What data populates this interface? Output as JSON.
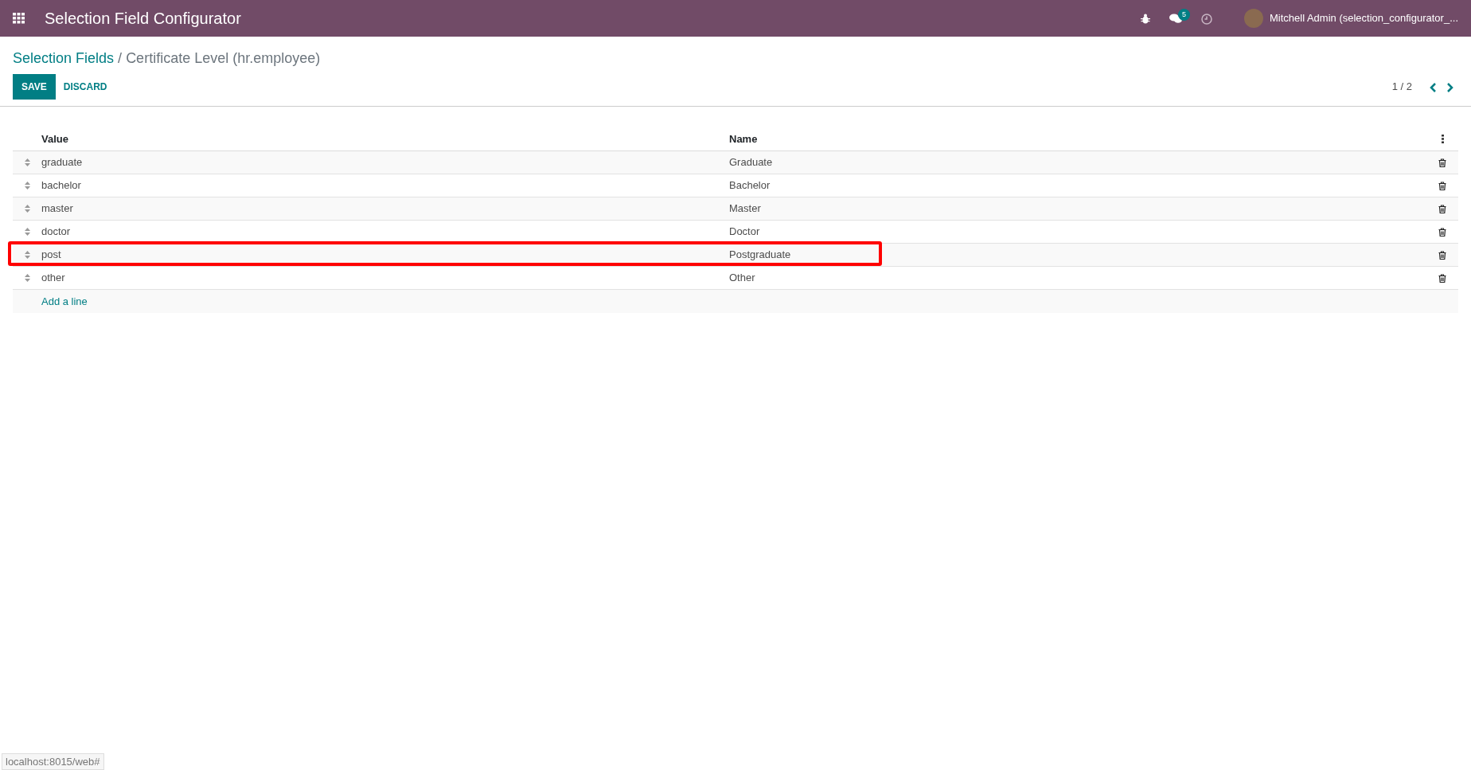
{
  "navbar": {
    "app_title": "Selection Field Configurator",
    "message_count": "5",
    "user": "Mitchell Admin (selection_configurator_..."
  },
  "breadcrumb": {
    "parent": "Selection Fields",
    "separator": "/",
    "current": "Certificate Level (hr.employee)"
  },
  "buttons": [
    "SAVE",
    "DISCARD"
  ],
  "pager": {
    "text": "1 / 2"
  },
  "table": {
    "columns": [
      "Value",
      "Name"
    ],
    "rows": [
      {
        "value": "graduate",
        "name": "Graduate",
        "highlighted": false
      },
      {
        "value": "bachelor",
        "name": "Bachelor",
        "highlighted": false
      },
      {
        "value": "master",
        "name": "Master",
        "highlighted": false
      },
      {
        "value": "doctor",
        "name": "Doctor",
        "highlighted": false
      },
      {
        "value": "post",
        "name": "Postgraduate",
        "highlighted": true
      },
      {
        "value": "other",
        "name": "Other",
        "highlighted": false
      }
    ],
    "add_line": "Add a line"
  },
  "status_bar": "localhost:8015/web#"
}
